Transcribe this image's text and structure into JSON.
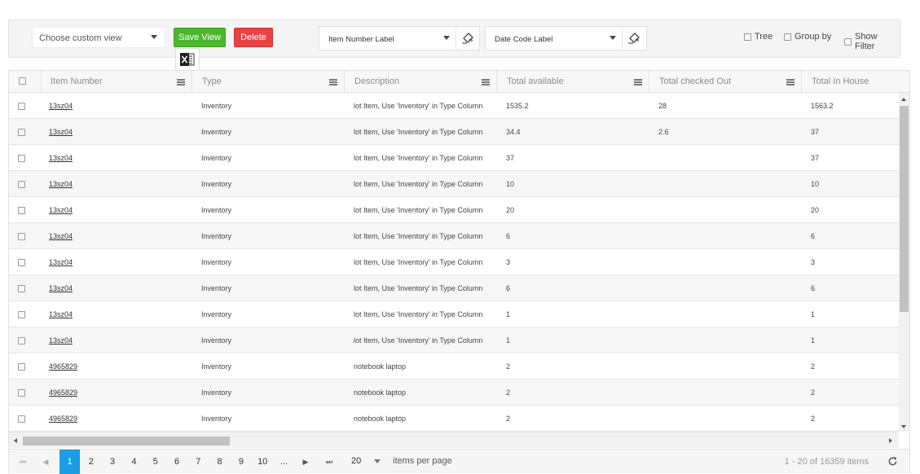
{
  "toolbar": {
    "custom_view_placeholder": "Choose custom view",
    "save_view_label": "Save View",
    "delete_label": "Delete",
    "item_number_label": "Item Number Label",
    "date_code_label": "Date Code Label",
    "tree_label": "Tree",
    "group_by_label": "Group by",
    "show_filter_label": "Show Filter",
    "colors": {
      "save": "#4cb72e",
      "delete": "#e84343"
    }
  },
  "grid": {
    "columns": [
      {
        "label": "Item Number"
      },
      {
        "label": "Type"
      },
      {
        "label": "Description"
      },
      {
        "label": "Total available"
      },
      {
        "label": "Total checked Out"
      },
      {
        "label": "Total In House"
      }
    ],
    "rows": [
      {
        "item": "13sz04",
        "type": "Inventory",
        "desc": "lot Item, Use 'Inventory' in Type Column",
        "available": "1535.2",
        "checked_out": "28",
        "in_house": "1563.2"
      },
      {
        "item": "13sz04",
        "type": "Inventory",
        "desc": "lot Item, Use 'Inventory' in Type Column",
        "available": "34.4",
        "checked_out": "2.6",
        "in_house": "37"
      },
      {
        "item": "13sz04",
        "type": "Inventory",
        "desc": "lot Item, Use 'Inventory' in Type Column",
        "available": "37",
        "checked_out": "",
        "in_house": "37"
      },
      {
        "item": "13sz04",
        "type": "Inventory",
        "desc": "lot Item, Use 'Inventory' in Type Column",
        "available": "10",
        "checked_out": "",
        "in_house": "10"
      },
      {
        "item": "13sz04",
        "type": "Inventory",
        "desc": "lot Item, Use 'Inventory' in Type Column",
        "available": "20",
        "checked_out": "",
        "in_house": "20"
      },
      {
        "item": "13sz04",
        "type": "Inventory",
        "desc": "lot Item, Use 'Inventory' in Type Column",
        "available": "6",
        "checked_out": "",
        "in_house": "6"
      },
      {
        "item": "13sz04",
        "type": "Inventory",
        "desc": "lot Item, Use 'Inventory' in Type Column",
        "available": "3",
        "checked_out": "",
        "in_house": "3"
      },
      {
        "item": "13sz04",
        "type": "Inventory",
        "desc": "lot Item, Use 'Inventory' in Type Column",
        "available": "6",
        "checked_out": "",
        "in_house": "6"
      },
      {
        "item": "13sz04",
        "type": "Inventory",
        "desc": "lot Item, Use 'Inventory' in Type Column",
        "available": "1",
        "checked_out": "",
        "in_house": "1"
      },
      {
        "item": "13sz04",
        "type": "Inventory",
        "desc": "lot Item, Use 'Inventory' in Type Column",
        "available": "1",
        "checked_out": "",
        "in_house": "1"
      },
      {
        "item": "4965829",
        "type": "Inventory",
        "desc": "notebook laptop",
        "available": "2",
        "checked_out": "",
        "in_house": "2"
      },
      {
        "item": "4965829",
        "type": "Inventory",
        "desc": "notebook laptop",
        "available": "2",
        "checked_out": "",
        "in_house": "2"
      },
      {
        "item": "4965829",
        "type": "Inventory",
        "desc": "notebook laptop",
        "available": "2",
        "checked_out": "",
        "in_house": "2"
      }
    ]
  },
  "pager": {
    "pages": [
      "1",
      "2",
      "3",
      "4",
      "5",
      "6",
      "7",
      "8",
      "9",
      "10",
      "..."
    ],
    "current_page": "1",
    "page_size": "20",
    "per_page_label": "items per page",
    "info": "1 - 20 of 16359 items",
    "active_color": "#1a9de2"
  }
}
